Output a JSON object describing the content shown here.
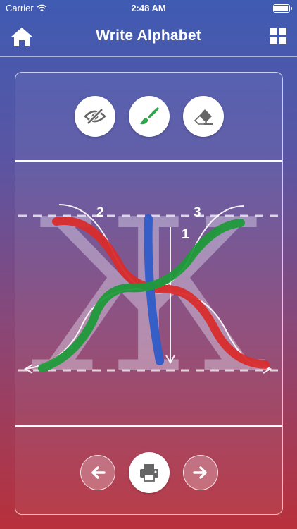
{
  "status": {
    "carrier": "Carrier",
    "time": "2:48 AM"
  },
  "header": {
    "title": "Write Alphabet"
  },
  "icons": {
    "home": "home-icon",
    "menu": "grid-icon",
    "visibility": "eye-slash-icon",
    "brush": "paintbrush-icon",
    "eraser": "eraser-icon",
    "previous": "arrow-left-icon",
    "print": "printer-icon",
    "next": "arrow-right-icon"
  },
  "letter": {
    "glyph": "Ж",
    "stroke_labels": [
      "1",
      "2",
      "3"
    ]
  },
  "colors": {
    "stroke_red": "#d82c2c",
    "stroke_blue": "#2f5cc8",
    "stroke_green": "#1f9a3a",
    "brush_icon": "#2aa84a"
  }
}
